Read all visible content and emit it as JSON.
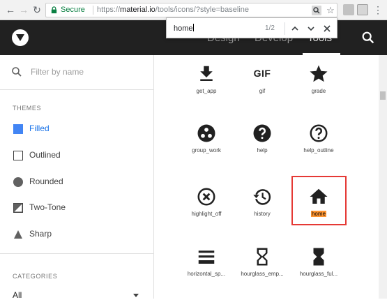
{
  "browser": {
    "secure_label": "Secure",
    "url_scheme": "https://",
    "url_host": "material.io",
    "url_path": "/tools/icons/?style=baseline"
  },
  "appbar": {
    "nav": [
      "Design",
      "Develop",
      "Tools"
    ],
    "active_index": 2
  },
  "findbar": {
    "query": "home",
    "count": "1/2"
  },
  "sidebar": {
    "filter_placeholder": "Filter by name",
    "themes_heading": "THEMES",
    "themes": [
      "Filled",
      "Outlined",
      "Rounded",
      "Two-Tone",
      "Sharp"
    ],
    "active_theme": "Filled",
    "categories_heading": "CATEGORIES",
    "category_value": "All"
  },
  "icons": [
    {
      "label": "get_app",
      "icon": "get-app-icon"
    },
    {
      "label": "gif",
      "icon": "gif-icon",
      "glyph_text": "GIF"
    },
    {
      "label": "grade",
      "icon": "star-icon"
    },
    {
      "label": "group_work",
      "icon": "group-work-icon"
    },
    {
      "label": "help",
      "icon": "help-icon"
    },
    {
      "label": "help_outline",
      "icon": "help-outline-icon"
    },
    {
      "label": "highlight_off",
      "icon": "highlight-off-icon"
    },
    {
      "label": "history",
      "icon": "history-icon"
    },
    {
      "label": "home",
      "icon": "home-icon"
    },
    {
      "label": "horizontal_sp...",
      "icon": "horizontal-split-icon"
    },
    {
      "label": "hourglass_emp...",
      "icon": "hourglass-empty-icon"
    },
    {
      "label": "hourglass_ful...",
      "icon": "hourglass-full-icon"
    }
  ],
  "colors": {
    "appbar": "#212121",
    "accent": "#1a73e8",
    "find_highlight": "#ff9632",
    "callout": "#e53935"
  }
}
